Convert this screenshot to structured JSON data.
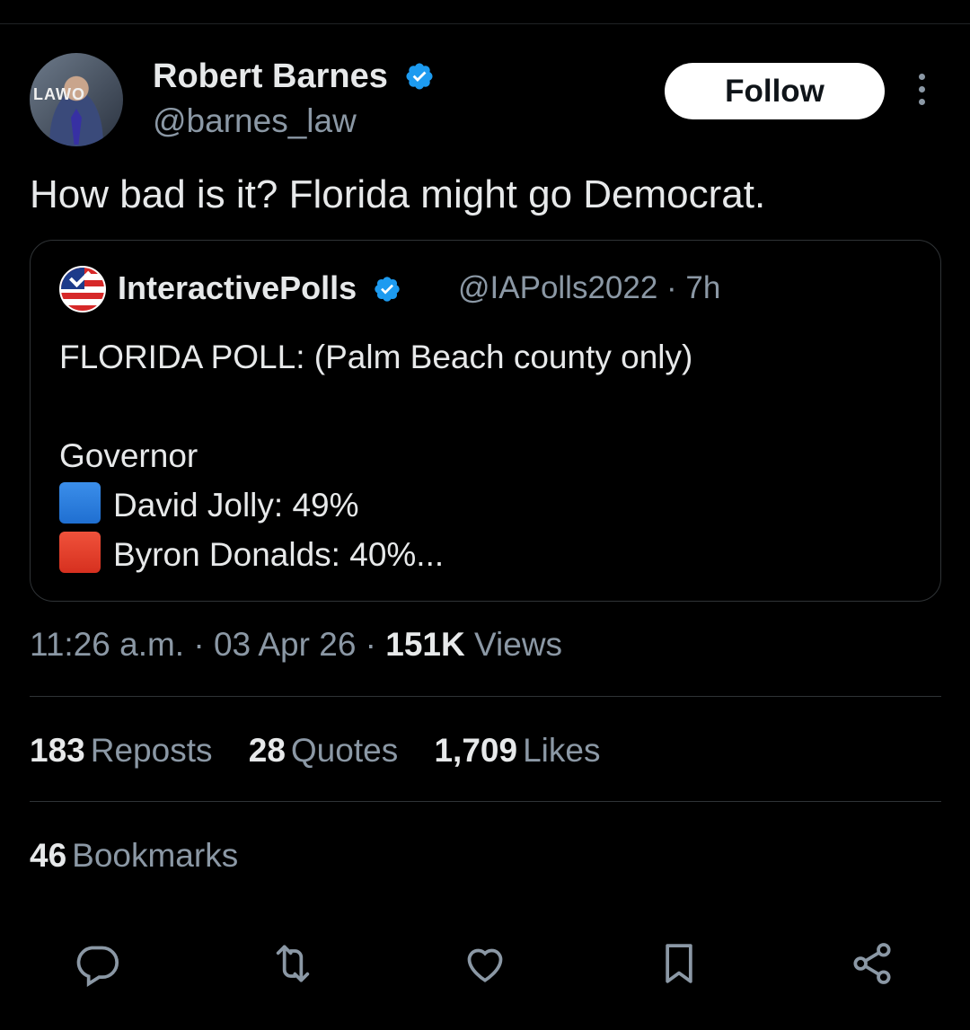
{
  "author": {
    "name": "Robert Barnes",
    "handle": "@barnes_law",
    "avatar_text": "LAWO"
  },
  "follow_label": "Follow",
  "tweet_text": "How bad is it? Florida might go Democrat.",
  "quoted": {
    "name": "InteractivePolls",
    "handle_time": "@IAPolls2022 · 7h",
    "lines": {
      "line1": "FLORIDA POLL: (Palm Beach county only)",
      "line2": "Governor",
      "line3": "David Jolly: 49%",
      "line4": "Byron Donalds: 40%..."
    }
  },
  "meta": {
    "time": "11:26 a.m.",
    "date": "03 Apr 26",
    "views_count": "151K",
    "views_label": "Views"
  },
  "stats": {
    "reposts_count": "183",
    "reposts_label": "Reposts",
    "quotes_count": "28",
    "quotes_label": "Quotes",
    "likes_count": "1,709",
    "likes_label": "Likes",
    "bookmarks_count": "46",
    "bookmarks_label": "Bookmarks"
  },
  "icons": {
    "verified": "verified-badge-icon",
    "reply": "reply-icon",
    "repost": "repost-icon",
    "like": "heart-icon",
    "bookmark": "bookmark-icon",
    "share": "share-icon"
  },
  "colors": {
    "background": "#000000",
    "verified_blue": "#1d9bf0",
    "secondary_text": "#8b98a5"
  }
}
